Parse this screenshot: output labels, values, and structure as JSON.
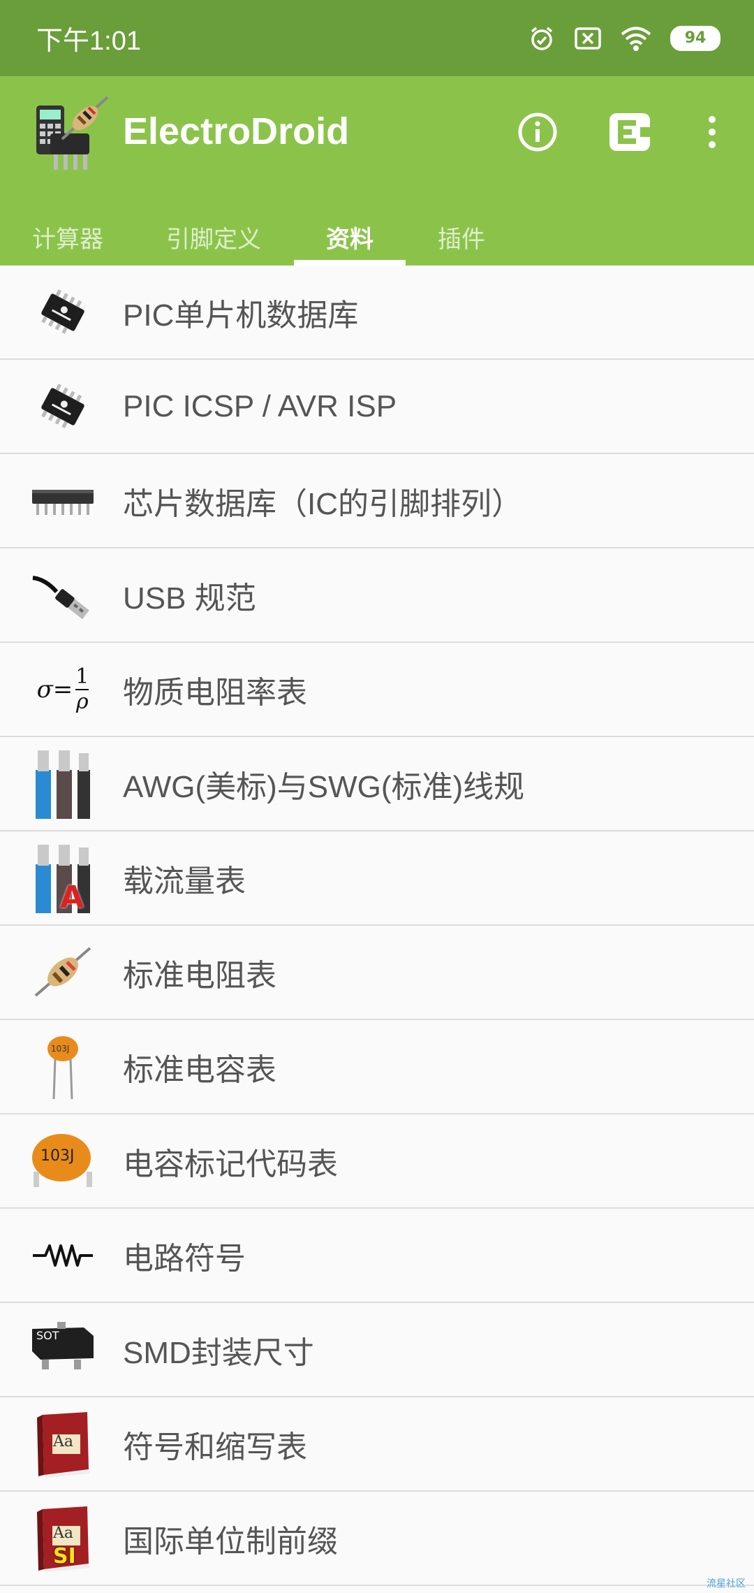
{
  "status": {
    "time": "下午1:01",
    "battery": "94"
  },
  "app": {
    "title": "ElectroDroid"
  },
  "tabs": [
    "计算器",
    "引脚定义",
    "资料",
    "插件"
  ],
  "items": [
    {
      "label": "PIC单片机数据库",
      "icon": "microchip-icon"
    },
    {
      "label": "PIC ICSP / AVR ISP",
      "icon": "microchip-icon"
    },
    {
      "label": "芯片数据库（IC的引脚排列）",
      "icon": "dip-chip-icon"
    },
    {
      "label": "USB 规范",
      "icon": "usb-plug-icon"
    },
    {
      "label": "物质电阻率表",
      "icon": "resistivity-formula-icon"
    },
    {
      "label": "AWG(美标)与SWG(标准)线规",
      "icon": "wire-gauge-icon"
    },
    {
      "label": "载流量表",
      "icon": "ampacity-icon"
    },
    {
      "label": "标准电阻表",
      "icon": "resistor-icon"
    },
    {
      "label": "标准电容表",
      "icon": "capacitor-icon"
    },
    {
      "label": "电容标记代码表",
      "icon": "capacitor-code-icon"
    },
    {
      "label": "电路符号",
      "icon": "resistor-symbol-icon"
    },
    {
      "label": "SMD封装尺寸",
      "icon": "sot-package-icon"
    },
    {
      "label": "符号和缩写表",
      "icon": "dictionary-book-icon"
    },
    {
      "label": "国际单位制前缀",
      "icon": "si-book-icon"
    }
  ],
  "icon_text": {
    "sot": "SOT",
    "cap_small": "103J",
    "cap_big": "103J",
    "book": "Aa",
    "si": "SI",
    "ampacity": "A",
    "formula_left": "σ=",
    "formula_num": "1",
    "formula_den": "ρ"
  },
  "watermark": "流星社区",
  "colors": {
    "statusbar": "#6a9e3a",
    "appbar": "#8bc34a",
    "list_bg": "#fafafa",
    "label": "#555555"
  }
}
